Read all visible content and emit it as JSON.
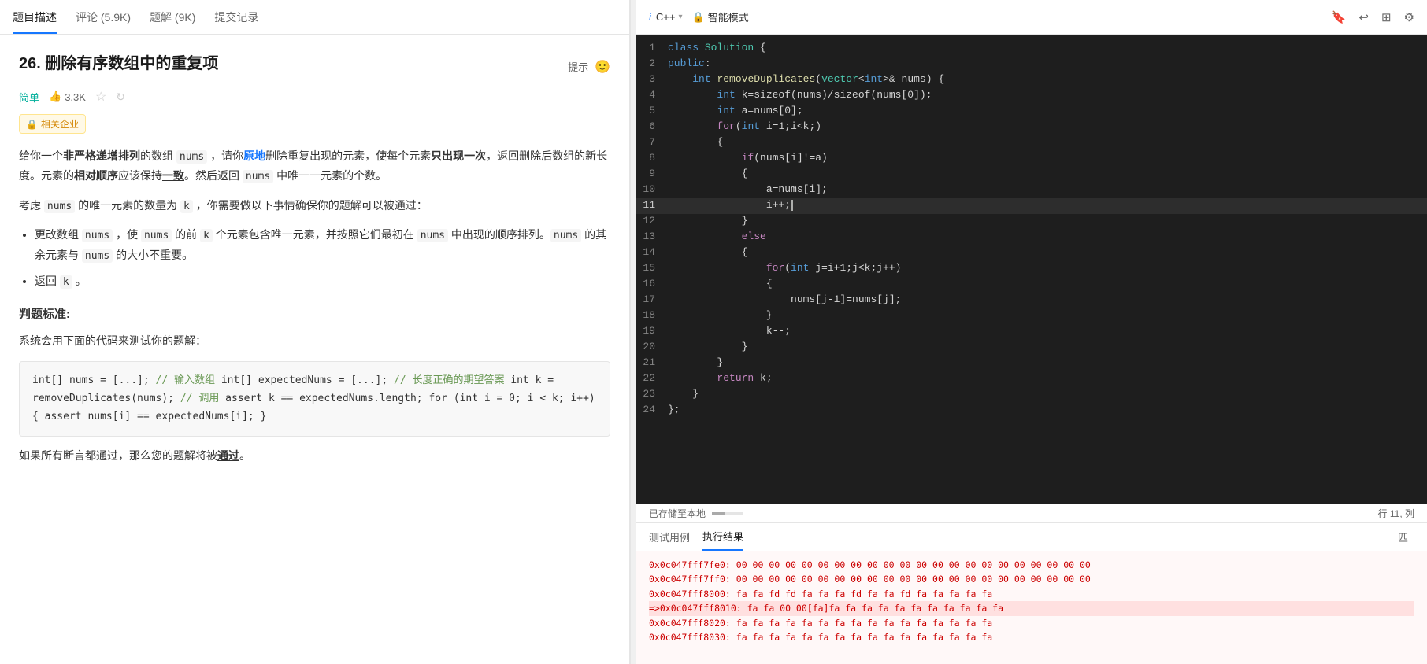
{
  "tabs": {
    "items": [
      {
        "label": "题目描述",
        "active": true
      },
      {
        "label": "评论 (5.9K)",
        "active": false
      },
      {
        "label": "题解 (9K)",
        "active": false
      },
      {
        "label": "提交记录",
        "active": false
      }
    ]
  },
  "problem": {
    "number": "26.",
    "title": "删除有序数组中的重复项",
    "hint_label": "提示",
    "difficulty": "简单",
    "likes": "3.3K",
    "company_tag": "相关企业",
    "desc_line1": "给你一个",
    "desc_bold1": "非严格递增排列",
    "desc_line2": "的数组",
    "desc_code1": "nums",
    "desc_line3": "，请你",
    "desc_link1": "原地",
    "desc_line4": "删除重复出现的元素，使每个元素",
    "desc_bold2": "只出现一次",
    "desc_line5": "，返回删除后数组的新长度。元素的",
    "desc_bold3": "相对顺序",
    "desc_line6": "应该保持",
    "desc_bold4": "一致",
    "desc_line7": "。然后返回",
    "desc_code2": "nums",
    "desc_line8": "中唯一一元素的个数。",
    "consider_line1": "考虑",
    "consider_code": "nums",
    "consider_line2": "的唯一元素的数量为",
    "consider_k": "k",
    "consider_line3": "，你需要做以下事情确保你的题解可以被通过：",
    "bullet1_line1": "更改数组",
    "bullet1_code1": "nums",
    "bullet1_line2": "，使",
    "bullet1_code2": "nums",
    "bullet1_line3": "的前",
    "bullet1_k": "k",
    "bullet1_line4": "个元素包含唯一元素，并按照它们最初在",
    "bullet1_code3": "nums",
    "bullet1_line5": "中出现的顺序排列。",
    "bullet1_line6": "nums",
    "bullet1_line7": "的其余元素与",
    "bullet1_code4": "nums",
    "bullet1_line8": "的大小不重要。",
    "bullet2": "返回 k 。",
    "judge_title": "判题标准:",
    "judge_desc": "系统会用下面的代码来测试你的题解：",
    "code_block": "    int[] nums = [...]; // 输入数组\n    int[] expectedNums = [...]; // 长度正确的期望答案\n\n    int k = removeDuplicates(nums); // 调用\n\n    assert k == expectedNums.length;\n    for (int i = 0; i < k; i++) {\n        assert nums[i] == expectedNums[i];\n    }",
    "pass_line1": "如果所有断言都通过，那么您的题解将被",
    "pass_bold": "通过",
    "pass_end": "。"
  },
  "editor": {
    "lang": "i C++",
    "mode": "智能模式",
    "status": "已存储至本地",
    "position": "行 11, 列",
    "lines": [
      {
        "num": 1,
        "tokens": [
          {
            "t": "kw",
            "v": "class"
          },
          {
            "t": "text",
            "v": " "
          },
          {
            "t": "cls",
            "v": "Solution"
          },
          {
            "t": "text",
            "v": " {"
          }
        ]
      },
      {
        "num": 2,
        "tokens": [
          {
            "t": "kw",
            "v": "public"
          },
          {
            "t": "text",
            "v": ":"
          }
        ]
      },
      {
        "num": 3,
        "tokens": [
          {
            "t": "text",
            "v": "    "
          },
          {
            "t": "kw",
            "v": "int"
          },
          {
            "t": "text",
            "v": " "
          },
          {
            "t": "fn",
            "v": "removeDuplicates"
          },
          {
            "t": "text",
            "v": "("
          },
          {
            "t": "type",
            "v": "vector"
          },
          {
            "t": "text",
            "v": "<"
          },
          {
            "t": "kw",
            "v": "int"
          },
          {
            "t": "text",
            "v": ">& nums) {"
          }
        ]
      },
      {
        "num": 4,
        "tokens": [
          {
            "t": "text",
            "v": "        "
          },
          {
            "t": "kw",
            "v": "int"
          },
          {
            "t": "text",
            "v": " k=sizeof(nums)/sizeof(nums[0]);"
          }
        ]
      },
      {
        "num": 5,
        "tokens": [
          {
            "t": "text",
            "v": "        "
          },
          {
            "t": "kw",
            "v": "int"
          },
          {
            "t": "text",
            "v": " a=nums[0];"
          }
        ]
      },
      {
        "num": 6,
        "tokens": [
          {
            "t": "text",
            "v": "        "
          },
          {
            "t": "kw2",
            "v": "for"
          },
          {
            "t": "text",
            "v": "("
          },
          {
            "t": "kw",
            "v": "int"
          },
          {
            "t": "text",
            "v": " i=1;i<k;)"
          }
        ]
      },
      {
        "num": 7,
        "tokens": [
          {
            "t": "text",
            "v": "        {"
          }
        ]
      },
      {
        "num": 8,
        "tokens": [
          {
            "t": "text",
            "v": "            "
          },
          {
            "t": "kw2",
            "v": "if"
          },
          {
            "t": "text",
            "v": "(nums[i]!=a)"
          }
        ]
      },
      {
        "num": 9,
        "tokens": [
          {
            "t": "text",
            "v": "            {"
          }
        ]
      },
      {
        "num": 10,
        "tokens": [
          {
            "t": "text",
            "v": "                a=nums[i];"
          }
        ]
      },
      {
        "num": 11,
        "tokens": [
          {
            "t": "text",
            "v": "                i++;"
          }
        ],
        "cursor": true
      },
      {
        "num": 12,
        "tokens": [
          {
            "t": "text",
            "v": "            }"
          }
        ]
      },
      {
        "num": 13,
        "tokens": [
          {
            "t": "text",
            "v": "            "
          },
          {
            "t": "kw2",
            "v": "else"
          }
        ]
      },
      {
        "num": 14,
        "tokens": [
          {
            "t": "text",
            "v": "            {"
          }
        ]
      },
      {
        "num": 15,
        "tokens": [
          {
            "t": "text",
            "v": "                "
          },
          {
            "t": "kw2",
            "v": "for"
          },
          {
            "t": "text",
            "v": "("
          },
          {
            "t": "kw",
            "v": "int"
          },
          {
            "t": "text",
            "v": " j=i+1;j<k;j++)"
          }
        ]
      },
      {
        "num": 16,
        "tokens": [
          {
            "t": "text",
            "v": "                {"
          }
        ]
      },
      {
        "num": 17,
        "tokens": [
          {
            "t": "text",
            "v": "                    nums[j-1]=nums[j];"
          }
        ]
      },
      {
        "num": 18,
        "tokens": [
          {
            "t": "text",
            "v": "                }"
          }
        ]
      },
      {
        "num": 19,
        "tokens": [
          {
            "t": "text",
            "v": "                k--;"
          }
        ]
      },
      {
        "num": 20,
        "tokens": [
          {
            "t": "text",
            "v": "            }"
          }
        ]
      },
      {
        "num": 21,
        "tokens": [
          {
            "t": "text",
            "v": "        }"
          }
        ]
      },
      {
        "num": 22,
        "tokens": [
          {
            "t": "text",
            "v": "        "
          },
          {
            "t": "kw2",
            "v": "return"
          },
          {
            "t": "text",
            "v": " k;"
          }
        ]
      },
      {
        "num": 23,
        "tokens": [
          {
            "t": "text",
            "v": "    }"
          }
        ]
      },
      {
        "num": 24,
        "tokens": [
          {
            "t": "text",
            "v": "};"
          }
        ]
      }
    ]
  },
  "bottom": {
    "tabs": [
      {
        "label": "测试用例",
        "active": false
      },
      {
        "label": "执行结果",
        "active": true
      }
    ],
    "hex_lines": [
      {
        "text": "0x0c047fff7fe0: 00 00 00 00 00 00 00 00 00 00 00 00 00 00 00 00",
        "highlighted": false
      },
      {
        "text": "0x0c047fff7ff0: 00 00 00 00 00 00 00 00 00 00 00 00 00 00 00 00",
        "highlighted": false
      },
      {
        "text": "0x0c047fff8000: fa fa fd fd fa fa fa fd fa fa fd fa fa fa fa fa",
        "highlighted": false
      },
      {
        "text": "=>0x0c047fff8010: fa fa 00 00[fa]fa fa fa fa fa fa fa fa fa fa fa",
        "highlighted": true
      },
      {
        "text": "0x0c047fff8020: fa fa fa fa fa fa fa fa fa fa fa fa fa fa fa fa",
        "highlighted": false
      },
      {
        "text": "0x0c047fff8030: fa fa fa fa fa fa fa fa fa fa fa fa fa fa fa fa",
        "highlighted": false
      }
    ],
    "right_btn": "匹"
  }
}
